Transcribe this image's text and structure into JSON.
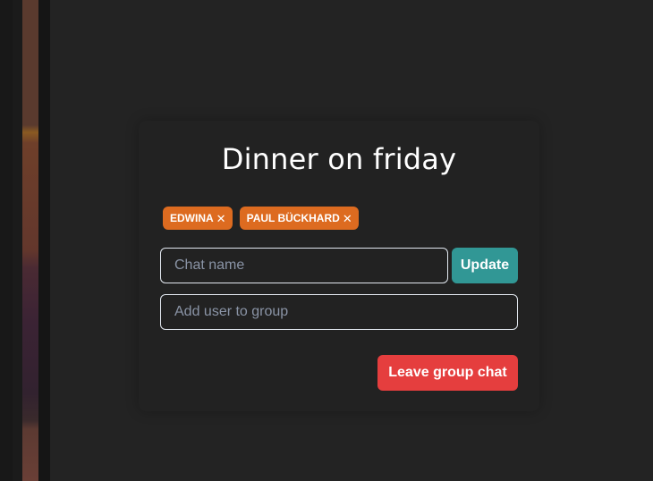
{
  "modal": {
    "title": "Dinner on friday",
    "members": [
      {
        "name": "EDWINA",
        "remove_icon": "close-icon"
      },
      {
        "name": "PAUL BÜCKHARD",
        "remove_icon": "close-icon"
      }
    ],
    "chat_name": {
      "value": "",
      "placeholder": "Chat name"
    },
    "update_label": "Update",
    "add_user": {
      "value": "",
      "placeholder": "Add user to group"
    },
    "leave_label": "Leave group chat"
  },
  "colors": {
    "background": "#232323",
    "tag": "#dd6b20",
    "update_button": "#319795",
    "leave_button": "#e53e3e"
  }
}
